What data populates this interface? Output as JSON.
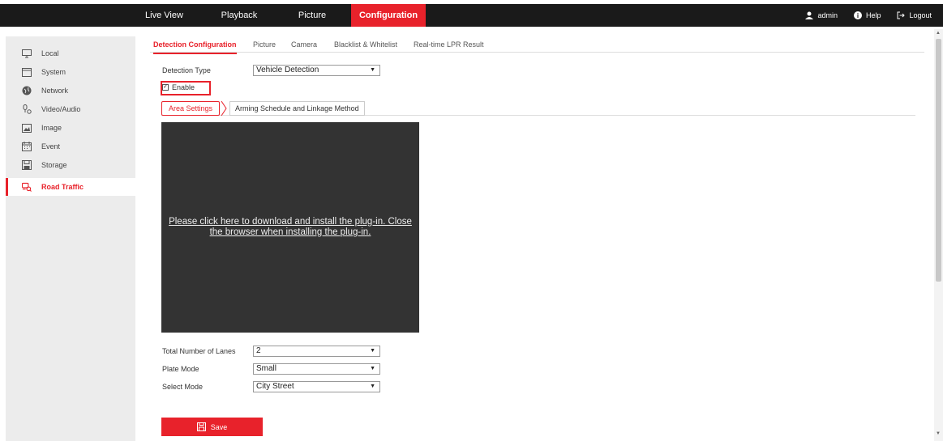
{
  "topnav": {
    "items": [
      {
        "label": "Live View",
        "active": false
      },
      {
        "label": "Playback",
        "active": false
      },
      {
        "label": "Picture",
        "active": false
      },
      {
        "label": "Configuration",
        "active": true
      }
    ],
    "user": "admin",
    "help": "Help",
    "logout": "Logout"
  },
  "sidebar": {
    "items": [
      {
        "label": "Local",
        "icon": "monitor-icon"
      },
      {
        "label": "System",
        "icon": "system-icon"
      },
      {
        "label": "Network",
        "icon": "globe-icon"
      },
      {
        "label": "Video/Audio",
        "icon": "video-audio-icon"
      },
      {
        "label": "Image",
        "icon": "image-icon"
      },
      {
        "label": "Event",
        "icon": "calendar-icon"
      },
      {
        "label": "Storage",
        "icon": "storage-icon"
      },
      {
        "label": "Road Traffic",
        "icon": "road-traffic-icon",
        "active": true
      }
    ]
  },
  "tabs": [
    {
      "label": "Detection Configuration",
      "active": true
    },
    {
      "label": "Picture"
    },
    {
      "label": "Camera"
    },
    {
      "label": "Blacklist & Whitelist"
    },
    {
      "label": "Real-time LPR Result"
    }
  ],
  "form": {
    "detection_type_label": "Detection Type",
    "detection_type_value": "Vehicle Detection",
    "enable_label": "Enable",
    "enable_checked": true,
    "lanes_label": "Total Number of Lanes",
    "lanes_value": "2",
    "plate_mode_label": "Plate Mode",
    "plate_mode_value": "Small",
    "select_mode_label": "Select Mode",
    "select_mode_value": "City Street"
  },
  "subtabs": {
    "area": "Area Settings",
    "arming": "Arming Schedule and Linkage Method"
  },
  "plugin_message": "Please click here to download and install the plug-in. Close the browser when installing the plug-in.",
  "save_label": "Save",
  "colors": {
    "accent": "#e8222b",
    "topbar": "#1a1a1a",
    "sidebar": "#ececec",
    "plugin_bg": "#333333"
  }
}
